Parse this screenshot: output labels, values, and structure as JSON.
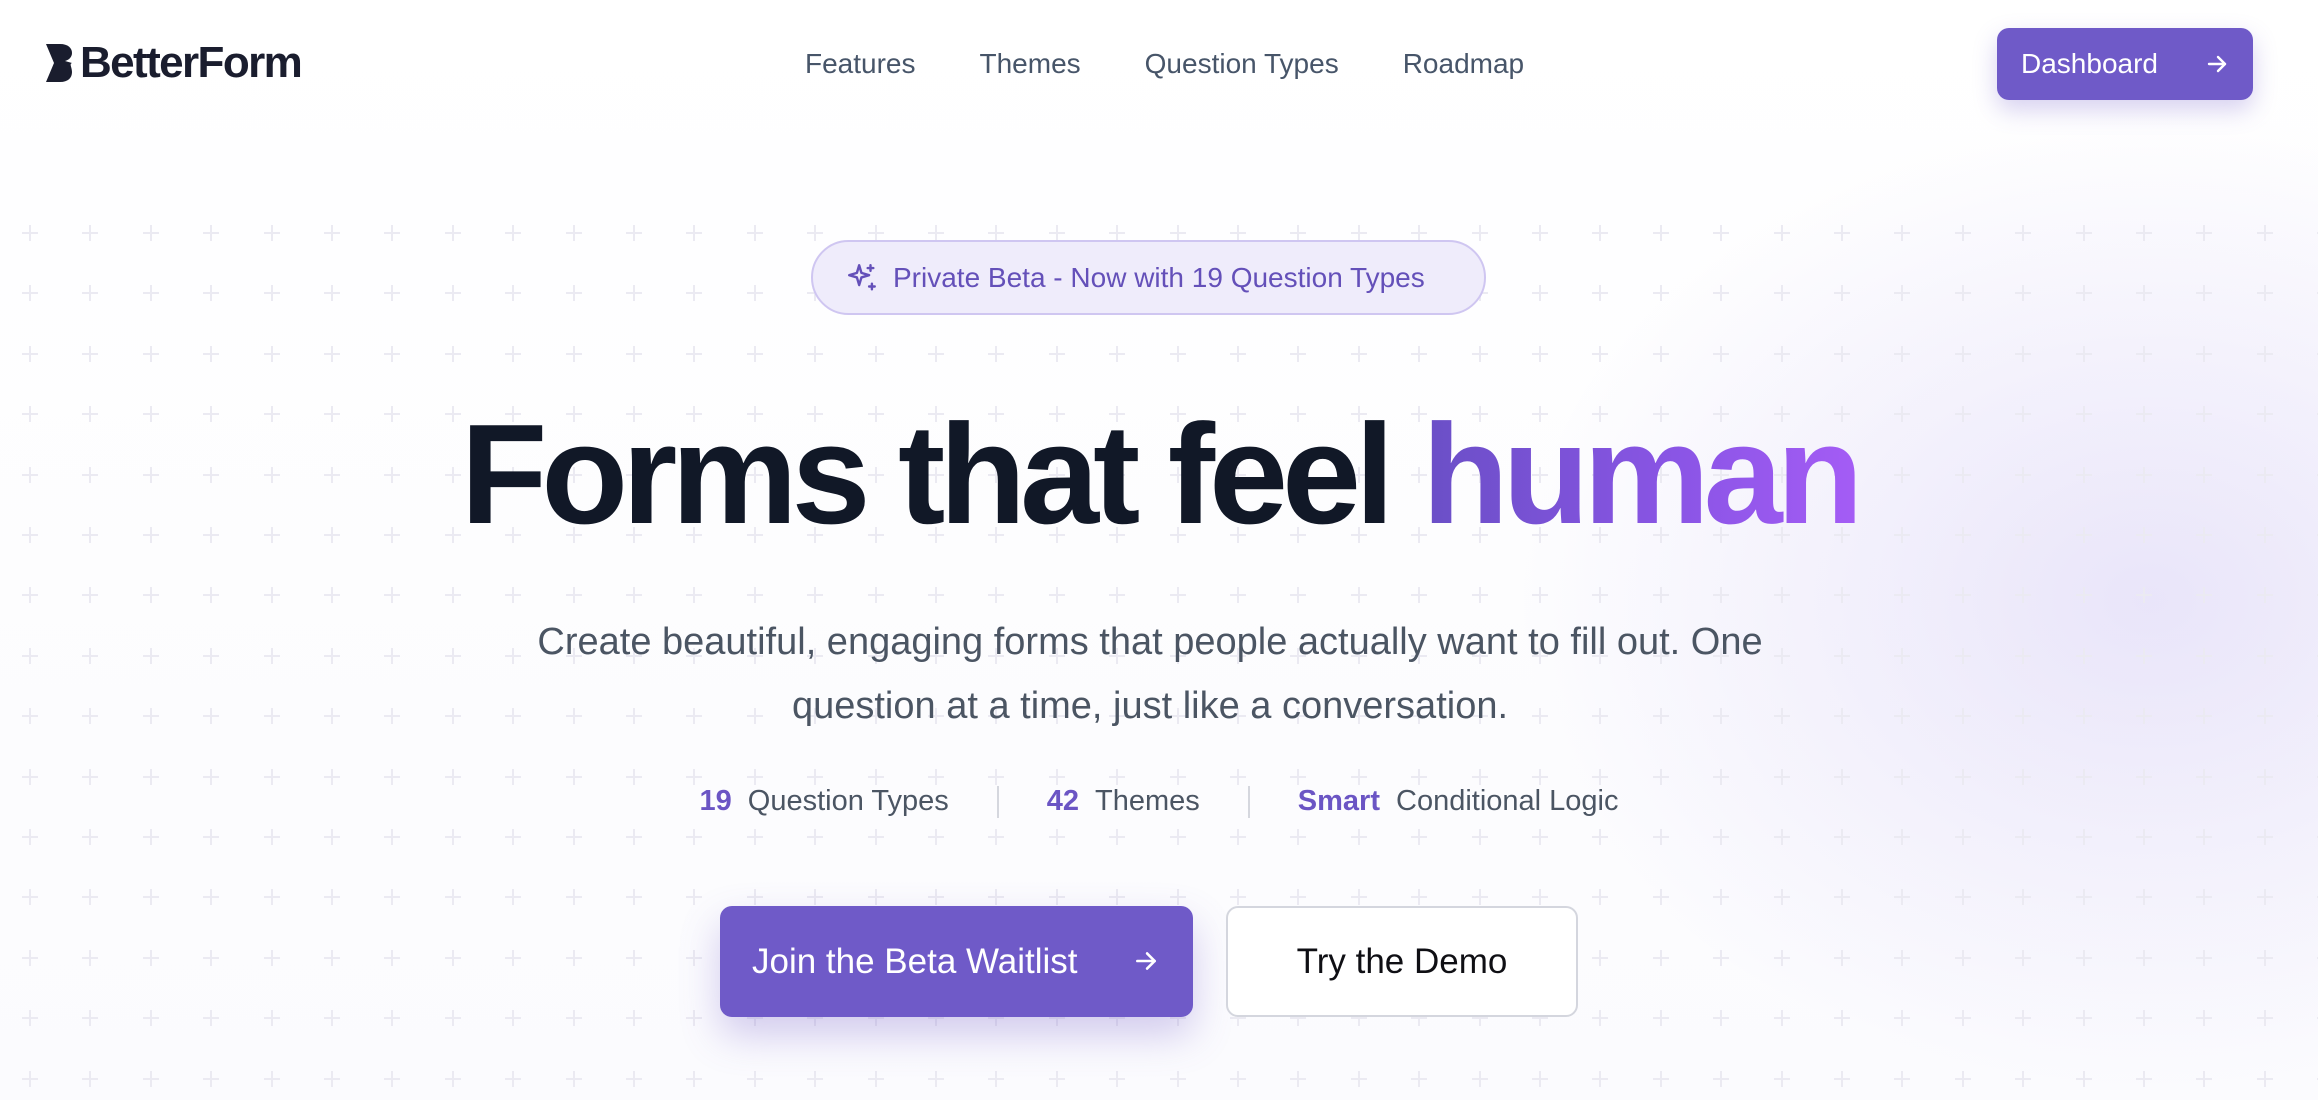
{
  "brand": {
    "name": "BetterForm",
    "accent_color": "#6f5ac8"
  },
  "nav": {
    "items": [
      {
        "label": "Features"
      },
      {
        "label": "Themes"
      },
      {
        "label": "Question Types"
      },
      {
        "label": "Roadmap"
      }
    ],
    "dashboard_label": "Dashboard",
    "dashboard_icon": "arrow-right-icon"
  },
  "hero": {
    "badge": {
      "icon": "sparkles-icon",
      "text": "Private Beta - Now with 19 Question Types"
    },
    "headline_main": "Forms that feel ",
    "headline_accent": "human",
    "subtitle": "Create beautiful, engaging forms that people actually want to fill out. One question at a time, just like a conversation.",
    "stats": [
      {
        "value": "19",
        "label": "Question Types"
      },
      {
        "value": "42",
        "label": "Themes"
      },
      {
        "value": "Smart",
        "label": "Conditional Logic"
      }
    ],
    "primary_cta": "Join the Beta Waitlist",
    "secondary_cta": "Try the Demo"
  }
}
